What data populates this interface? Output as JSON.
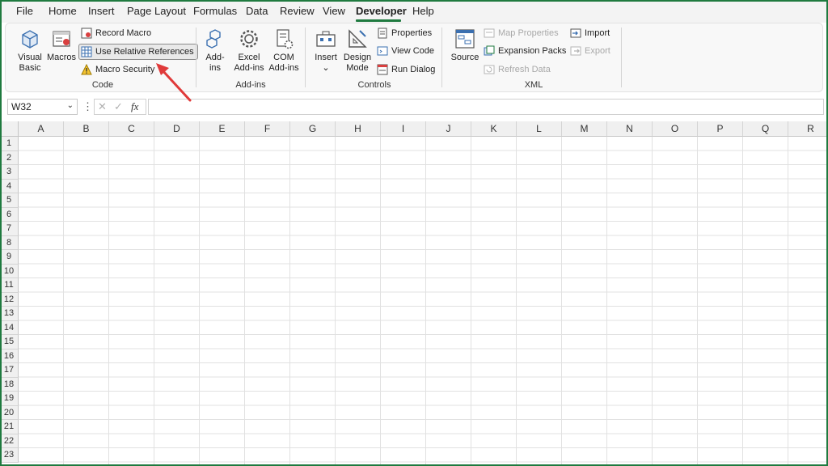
{
  "menu": {
    "items": [
      "File",
      "Home",
      "Insert",
      "Page Layout",
      "Formulas",
      "Data",
      "Review",
      "View",
      "Developer",
      "Help"
    ],
    "active": "Developer"
  },
  "ribbon": {
    "code": {
      "label": "Code",
      "visual_basic": "Visual\nBasic",
      "macros": "Macros",
      "record_macro": "Record Macro",
      "use_relative_references": "Use Relative References",
      "macro_security": "Macro Security"
    },
    "addins": {
      "label": "Add-ins",
      "addins": "Add-\nins",
      "excel_addins": "Excel\nAdd-ins",
      "com_addins": "COM\nAdd-ins"
    },
    "controls": {
      "label": "Controls",
      "insert": "Insert",
      "insert_caret": "⌄",
      "design_mode": "Design\nMode",
      "properties": "Properties",
      "view_code": "View Code",
      "run_dialog": "Run Dialog"
    },
    "xml": {
      "label": "XML",
      "source": "Source",
      "map_properties": "Map Properties",
      "expansion_packs": "Expansion Packs",
      "refresh_data": "Refresh Data",
      "import": "Import",
      "export": "Export"
    }
  },
  "formula_bar": {
    "name_box": "W32",
    "name_box_caret": "⌄",
    "kebab": "⋮",
    "cancel": "✕",
    "enter": "✓",
    "fx": "fx",
    "formula": ""
  },
  "sheet": {
    "columns": [
      "A",
      "B",
      "C",
      "D",
      "E",
      "F",
      "G",
      "H",
      "I",
      "J",
      "K",
      "L",
      "M",
      "N",
      "O",
      "P",
      "Q",
      "R"
    ],
    "rows": [
      "1",
      "2",
      "3",
      "4",
      "5",
      "6",
      "7",
      "8",
      "9",
      "10",
      "11",
      "12",
      "13",
      "14",
      "15",
      "16",
      "17",
      "18",
      "19",
      "20",
      "21",
      "22",
      "23"
    ]
  },
  "colors": {
    "accent": "#1f7a3f",
    "annotation_arrow": "#e03a3a"
  }
}
